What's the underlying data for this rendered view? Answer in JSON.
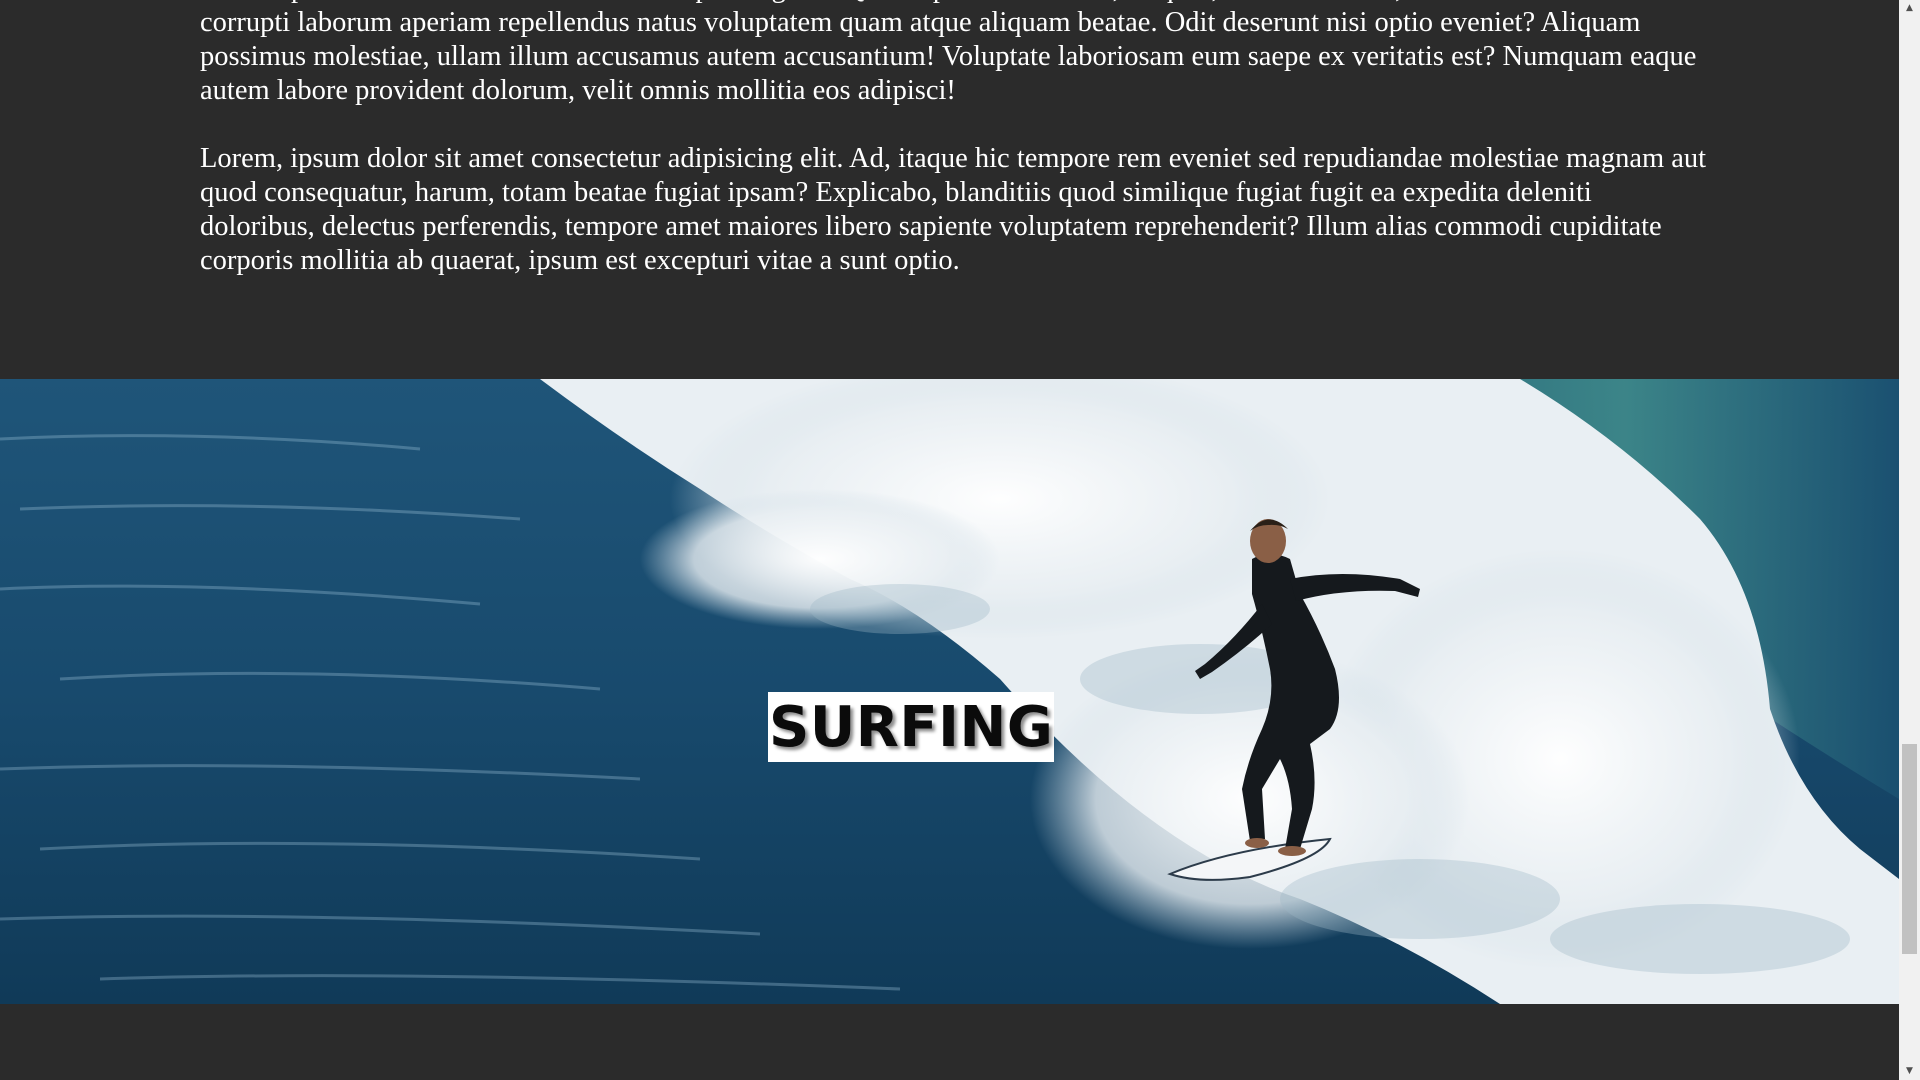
{
  "content": {
    "paragraphs": [
      "Lorem ipsum dolor sit amet consectetur adipisicing elit. Quam aperiam nostrum, ea quas, exercitationem, recusandae dolore corrupti laborum aperiam repellendus natus voluptatem quam atque aliquam beatae. Odit deserunt nisi optio eveniet? Aliquam possimus molestiae, ullam illum accusamus autem accusantium! Voluptate laboriosam eum saepe ex veritatis est? Numquam eaque autem labore provident dolorum, velit omnis mollitia eos adipisci!",
      "Lorem, ipsum dolor sit amet consectetur adipisicing elit. Ad, itaque hic tempore rem eveniet sed repudiandae molestiae magnam aut quod consequatur, harum, totam beatae fugiat ipsam? Explicabo, blanditiis quod similique fugiat fugit ea expedita deleniti doloribus, delectus perferendis, tempore amet maiores libero sapiente voluptatem reprehenderit? Illum alias commodi cupiditate corporis mollitia ab quaerat, ipsum est excepturi vitae a sunt optio."
    ]
  },
  "hero": {
    "title": "SURFING",
    "image_subject": "surfer-riding-wave-photo"
  },
  "scrollbar": {
    "up_arrow_icon": "scroll-up-arrow-icon",
    "down_arrow_icon": "scroll-down-arrow-icon",
    "up_glyph": "▲",
    "down_glyph": "▼"
  },
  "colors": {
    "page_background": "#2b2b2b",
    "text": "#ffffff",
    "ocean": "#17486b",
    "title_background": "#ffffff"
  }
}
